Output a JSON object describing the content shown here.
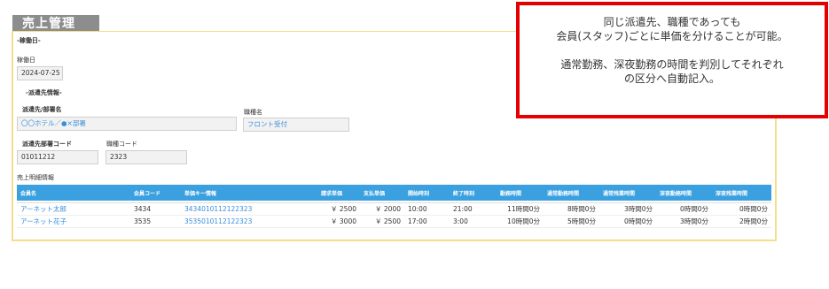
{
  "page": {
    "title": "売上管理"
  },
  "form": {
    "work_date_section": "-稼働日-",
    "work_date_label": "稼働日",
    "work_date_value": "2024-07-25",
    "dispatch_section": "-派遣先情報-",
    "dispatch_name_label": "派遣先/部署名",
    "dispatch_name_value": "〇〇ホテル／●×部署",
    "job_type_label": "職種名",
    "job_type_value": "フロント受付",
    "dept_code_label": "派遣先部署コード",
    "dept_code_value": "01011212",
    "job_code_label": "職種コード",
    "job_code_value": "2323"
  },
  "detail": {
    "section_label": "売上明細情報",
    "columns": [
      "会員名",
      "会員コード",
      "単価キー情報",
      "請求単価",
      "支払単価",
      "開始時刻",
      "終了時刻",
      "勤務時間",
      "通常勤務時間",
      "通常残業時間",
      "深夜勤務時間",
      "深夜残業時間"
    ],
    "rows": [
      {
        "name": "アーネット太郎",
        "code": "3434",
        "key": "3434010112122323",
        "bill": "￥ 2500",
        "pay": "￥ 2000",
        "start": "10:00",
        "end": "21:00",
        "work": "11時間0分",
        "normal": "8時間0分",
        "normal_ot": "3時間0分",
        "night": "0時間0分",
        "night_ot": "0時間0分"
      },
      {
        "name": "アーネット花子",
        "code": "3535",
        "key": "3535010112122323",
        "bill": "￥ 3000",
        "pay": "￥ 2500",
        "start": "17:00",
        "end": "3:00",
        "work": "10時間0分",
        "normal": "5時間0分",
        "normal_ot": "0時間0分",
        "night": "3時間0分",
        "night_ot": "2時間0分"
      }
    ]
  },
  "callout": {
    "line1": "同じ派遣先、職種であっても",
    "line2": "会員(スタッフ)ごとに単価を分けることが可能。",
    "line3": "通常勤務、深夜勤務の時間を判別してそれぞれ",
    "line4": "の区分へ自動記入。"
  },
  "colors": {
    "accent": "#3aa0e0",
    "panel_border": "#f6dd8c",
    "callout_border": "#e30000",
    "title_bg": "#8d8d8d"
  }
}
